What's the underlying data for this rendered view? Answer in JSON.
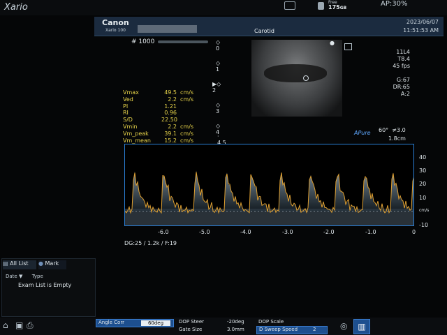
{
  "app": {
    "brand": "Xario",
    "ap": "AP:30%",
    "free_label": "Free",
    "free_value": "175",
    "free_unit": "GB"
  },
  "header": {
    "company": "Canon",
    "model": "Xario 100",
    "exam": "Carotid",
    "date": "2023/06/07",
    "time": "11:51:53 AM"
  },
  "image": {
    "frame": "# 1000",
    "depth_markers": [
      "0",
      "1",
      "2",
      "3",
      "4",
      "4.5"
    ],
    "params": [
      "11L4",
      "T8.4",
      "45 fps",
      "G:67",
      "DR:65",
      "A:2"
    ],
    "apure": "APure",
    "angle": "60°",
    "sample": "≠3.0",
    "depth_cm": "1.8cm"
  },
  "measurements": [
    {
      "label": "Vmax",
      "value": "49.5",
      "unit": "cm/s"
    },
    {
      "label": "Ved",
      "value": "2.2",
      "unit": "cm/s"
    },
    {
      "label": "PI",
      "value": "1.21",
      "unit": ""
    },
    {
      "label": "RI",
      "value": "0.96",
      "unit": ""
    },
    {
      "label": "S/D",
      "value": "22.50",
      "unit": ""
    },
    {
      "label": "Vmin",
      "value": "2.2",
      "unit": "cm/s"
    },
    {
      "label": "Vm_peak",
      "value": "39.1",
      "unit": "cm/s"
    },
    {
      "label": "Vm_mean",
      "value": "15.2",
      "unit": "cm/s"
    }
  ],
  "spectrum": {
    "y_ticks": [
      "40",
      "30",
      "20",
      "10",
      "cm/s",
      "-10"
    ],
    "x_ticks": [
      "-6.0",
      "-5.0",
      "-4.0",
      "-3.0",
      "-2.0",
      "-1.0",
      "0"
    ],
    "footer": "DG:25  / 1.2k  / F:19"
  },
  "left_panel": {
    "tab_all": "All List",
    "tab_mark": "Mark",
    "col_date": "Date ▼",
    "col_type": "Type",
    "empty": "Exam List is Empty"
  },
  "bottom": {
    "angle_corr": "Angle Corr",
    "angle_val": "60deg",
    "dop_steer": "DOP Steer",
    "dop_steer_val": "-20deg",
    "gate_size": "Gate Size",
    "gate_size_val": "3.0mm",
    "dop_scale": "DOP Scale",
    "sweep": "D Sweep Speed",
    "sweep_val": "2"
  }
}
